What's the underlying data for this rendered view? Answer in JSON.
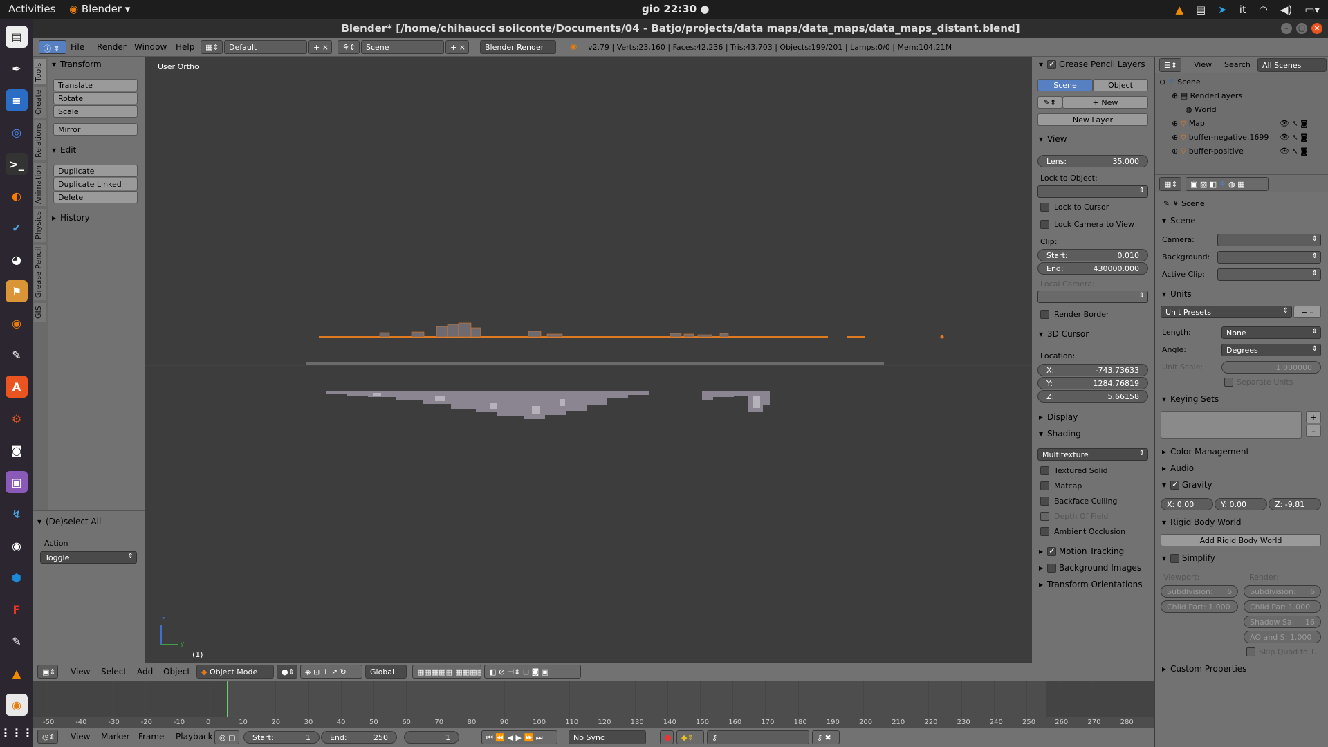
{
  "system": {
    "activities": "Activities",
    "app": "Blender",
    "clock": "gio 22:30 ●",
    "lang": "it"
  },
  "window": {
    "title": "Blender* [/home/chihaucci soilconte/Documents/04 - Batjo/projects/data maps/data_maps/data_maps_distant.blend]"
  },
  "info": {
    "menus": [
      "File",
      "Render",
      "Window",
      "Help"
    ],
    "layout": "Default",
    "scene": "Scene",
    "engine": "Blender Render",
    "stats": "v2.79 | Verts:23,160 | Faces:42,236 | Tris:43,703 | Objects:199/201 | Lamps:0/0 | Mem:104.21M"
  },
  "tabs": [
    "Tools",
    "Create",
    "Relations",
    "Animation",
    "Physics",
    "Grease Pencil",
    "GIS"
  ],
  "tools": {
    "transform": "Transform",
    "translate": "Translate",
    "rotate": "Rotate",
    "scale": "Scale",
    "mirror": "Mirror",
    "edit": "Edit",
    "duplicate": "Duplicate",
    "duplicate_linked": "Duplicate Linked",
    "delete": "Delete",
    "history": "History",
    "deselect": "(De)select All",
    "action": "Action",
    "toggle": "Toggle"
  },
  "viewport": {
    "label": "User Ortho",
    "frame": "(1)",
    "axis_z": "z",
    "axis_y": "y"
  },
  "npanel": {
    "gp_layers": "Grease Pencil Layers",
    "scene_btn": "Scene",
    "object_btn": "Object",
    "new": "New",
    "new_layer": "New Layer",
    "view": "View",
    "lens_label": "Lens:",
    "lens": "35.000",
    "lock_obj": "Lock to Object:",
    "lock_cursor": "Lock to Cursor",
    "lock_camera": "Lock Camera to View",
    "clip": "Clip:",
    "start_label": "Start:",
    "start": "0.010",
    "end_label": "End:",
    "end": "430000.000",
    "local_camera": "Local Camera:",
    "render_border": "Render Border",
    "cursor3d": "3D Cursor",
    "location": "Location:",
    "x_label": "X:",
    "x": "-743.73633",
    "y_label": "Y:",
    "y": "1284.76819",
    "z_label": "Z:",
    "z": "5.66158",
    "display": "Display",
    "shading": "Shading",
    "multitexture": "Multitexture",
    "textured_solid": "Textured Solid",
    "matcap": "Matcap",
    "backface": "Backface Culling",
    "dof": "Depth Of Field",
    "ao": "Ambient Occlusion",
    "motion": "Motion Tracking",
    "bg_images": "Background Images",
    "transform_orient": "Transform Orientations"
  },
  "outliner": {
    "view": "View",
    "search": "Search",
    "all_scenes": "All Scenes",
    "items": [
      "Scene",
      "RenderLayers",
      "World",
      "Map",
      "buffer-negative.1699",
      "buffer-positive"
    ]
  },
  "props": {
    "scene": "Scene",
    "scene_section": "Scene",
    "camera": "Camera:",
    "background": "Background:",
    "active_clip": "Active Clip:",
    "units": "Units",
    "unit_presets": "Unit Presets",
    "length": "Length:",
    "length_val": "None",
    "angle": "Angle:",
    "angle_val": "Degrees",
    "unit_scale": "Unit Scale:",
    "unit_scale_val": "1.000000",
    "separate_units": "Separate Units",
    "keying_sets": "Keying Sets",
    "color_mgmt": "Color Management",
    "audio": "Audio",
    "gravity": "Gravity",
    "gx": "X:  0.00",
    "gy": "Y:  0.00",
    "gz": "Z:  -9.81",
    "rigid": "Rigid Body World",
    "add_rigid": "Add Rigid Body World",
    "simplify": "Simplify",
    "viewport": "Viewport:",
    "render": "Render:",
    "subdiv": "Subdivision:",
    "subdiv_v": "6",
    "subdiv_r": "6",
    "child_part": "Child Part: 1.000",
    "child_par": "Child Par: 1.000",
    "shadow": "Shadow Sa:",
    "shadow_v": "16",
    "ao_sss": "AO and S: 1.000",
    "skip_quad": "Skip Quad to T...",
    "custom": "Custom Properties"
  },
  "vhead": {
    "menus": [
      "View",
      "Select",
      "Add",
      "Object"
    ],
    "mode": "Object Mode",
    "orient": "Global"
  },
  "timeline": {
    "ticks": [
      "-50",
      "-40",
      "-30",
      "-20",
      "-10",
      "0",
      "10",
      "20",
      "30",
      "40",
      "50",
      "60",
      "70",
      "80",
      "90",
      "100",
      "110",
      "120",
      "130",
      "140",
      "150",
      "160",
      "170",
      "180",
      "190",
      "200",
      "210",
      "220",
      "230",
      "240",
      "250",
      "260",
      "270",
      "280"
    ],
    "menus": [
      "View",
      "Marker",
      "Frame",
      "Playback"
    ],
    "start_label": "Start:",
    "start": "1",
    "end_label": "End:",
    "end": "250",
    "current": "1",
    "sync": "No Sync"
  }
}
